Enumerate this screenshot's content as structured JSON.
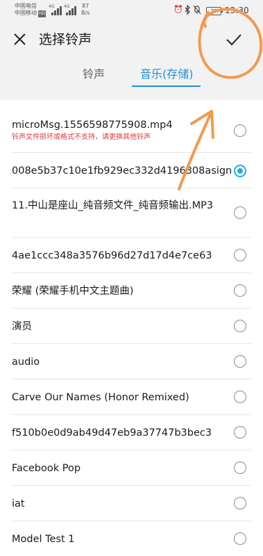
{
  "status_bar": {
    "carrier_1": "中国电信",
    "carrier_2": "中国移动",
    "hd_badge": "HD",
    "network_1": "4G",
    "network_2": "4G",
    "speed_value": "87",
    "speed_unit": "B/s",
    "icons": [
      "alarm-icon",
      "bluetooth-icon",
      "mute-icon"
    ],
    "battery": "72",
    "time": "13:30"
  },
  "header": {
    "title": "选择铃声",
    "close_icon": "close-icon",
    "confirm_icon": "check-icon"
  },
  "tabs": [
    {
      "label": "铃声",
      "active": false
    },
    {
      "label": "音乐(存储)",
      "active": true
    }
  ],
  "accent_color": "#1e90d6",
  "list": [
    {
      "name": "microMsg.1556598775908.mp4",
      "error": "铃声文件损坏或格式不支持，请更换其他铃声",
      "selected": false
    },
    {
      "name": "008e5b37c10e1fb929ec332d4196308asign",
      "selected": true
    },
    {
      "name": "11.中山是座山_纯音频文件_纯音频输出.MP3",
      "selected": false
    },
    {
      "name": "4ae1ccc348a3576b96d27d17d4e7ce63",
      "selected": false
    },
    {
      "name": "荣耀 (荣耀手机中文主题曲)",
      "selected": false
    },
    {
      "name": "演员",
      "selected": false
    },
    {
      "name": "audio",
      "selected": false
    },
    {
      "name": "Carve Our Names (Honor Remixed)",
      "selected": false
    },
    {
      "name": "f510b0e0d9ab49d47eb9a37747b3bec3",
      "selected": false
    },
    {
      "name": "Facebook Pop",
      "selected": false
    },
    {
      "name": "iat",
      "selected": false
    },
    {
      "name": "Model Test 1",
      "selected": false
    }
  ]
}
